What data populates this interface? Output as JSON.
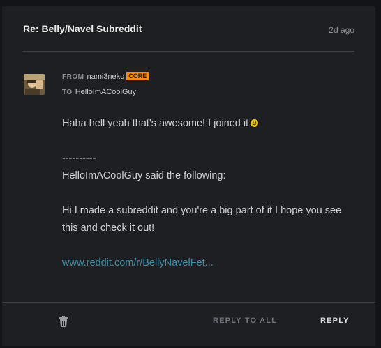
{
  "message": {
    "subject": "Re: Belly/Navel Subreddit",
    "time": "2d ago",
    "from_label": "FROM",
    "from_user": "nami3neko",
    "from_badge": "CORE",
    "to_label": "TO",
    "to_user": "HelloImACoolGuy",
    "body": {
      "line1": "Haha hell yeah that's awesome! I joined it",
      "separator": "----------",
      "quote_intro": "HelloImACoolGuy said the following:",
      "quote_text": "Hi I made a subreddit and you're a big part of it I hope you see this and check it out!",
      "link_text": "www.reddit.com/r/BellyNavelFet..."
    }
  },
  "actions": {
    "reply_all": "REPLY TO ALL",
    "reply": "REPLY"
  },
  "colors": {
    "background": "#121417",
    "panel": "#1d1f23",
    "badge": "#f48a1a",
    "link": "#3e8fa8"
  }
}
